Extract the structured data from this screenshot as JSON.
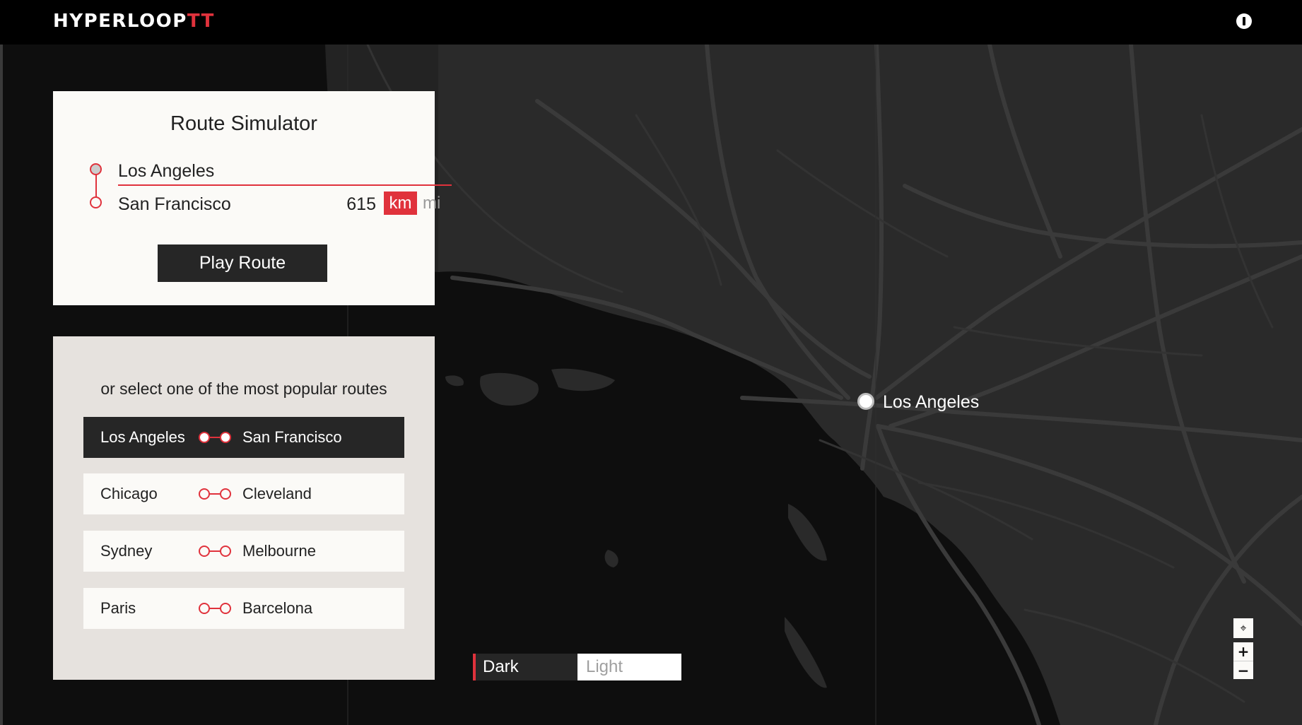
{
  "header": {
    "logo_main": "HYPERLOOP",
    "logo_accent": "TT"
  },
  "simulator": {
    "title": "Route Simulator",
    "origin": "Los Angeles",
    "destination": "San Francisco",
    "distance": "615",
    "unit_active": "km",
    "unit_inactive": "mi",
    "play_label": "Play Route"
  },
  "popular": {
    "heading": "or select one of the most popular routes",
    "routes": [
      {
        "from": "Los Angeles",
        "to": "San Francisco",
        "selected": true
      },
      {
        "from": "Chicago",
        "to": "Cleveland",
        "selected": false
      },
      {
        "from": "Sydney",
        "to": "Melbourne",
        "selected": false
      },
      {
        "from": "Paris",
        "to": "Barcelona",
        "selected": false
      }
    ]
  },
  "map": {
    "marker_label": "Los Angeles",
    "theme": {
      "dark_label": "Dark",
      "light_label": "Light",
      "selected": "Dark"
    },
    "controls": {
      "locate_icon": "crosshair-icon",
      "zoom_in": "+",
      "zoom_out": "−"
    }
  },
  "colors": {
    "accent": "#e0323c",
    "panel": "#fbfaf7",
    "panel_alt": "#e6e2de",
    "dark": "#262626"
  }
}
